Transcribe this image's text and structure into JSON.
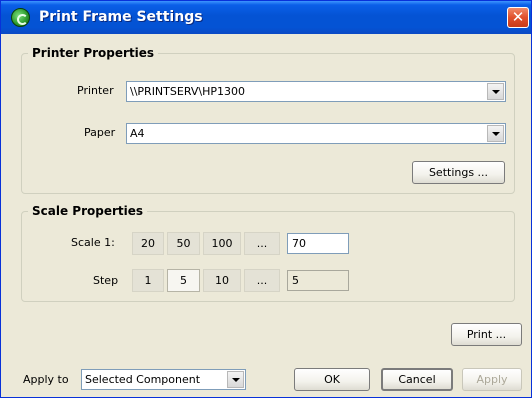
{
  "window": {
    "title": "Print Frame Settings"
  },
  "printer_properties": {
    "legend": "Printer Properties",
    "printer_label": "Printer",
    "printer_value": "\\\\PRINTSERV\\HP1300",
    "paper_label": "Paper",
    "paper_value": "A4",
    "settings_label": "Settings ..."
  },
  "scale_properties": {
    "legend": "Scale Properties",
    "scale_label": "Scale 1:",
    "scale_options": [
      "20",
      "50",
      "100",
      "..."
    ],
    "scale_value": "70",
    "step_label": "Step",
    "step_options": [
      "1",
      "5",
      "10",
      "..."
    ],
    "step_value": "5"
  },
  "footer": {
    "print_label": "Print ...",
    "apply_to_label": "Apply to",
    "apply_to_value": "Selected Component",
    "ok_label": "OK",
    "cancel_label": "Cancel",
    "apply_label": "Apply"
  },
  "colors": {
    "title_bar": "#0453d4",
    "close": "#e0502c",
    "dialog_bg": "#ece9d8"
  }
}
